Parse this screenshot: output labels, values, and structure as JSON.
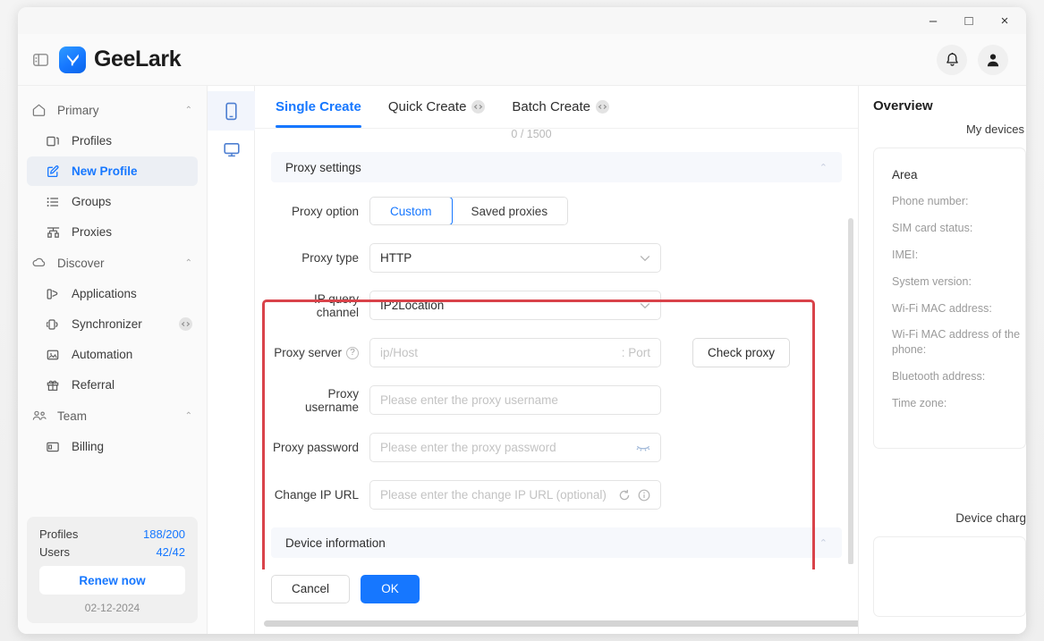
{
  "window": {
    "controls": {
      "minimize": "–",
      "maximize": "□",
      "close": "×"
    }
  },
  "header": {
    "brand_name": "GeeLark",
    "collapse_icon": "panel-collapse-icon",
    "bell_icon": "bell-icon",
    "account_icon": "account-avatar-icon"
  },
  "sidebar": {
    "groups": [
      {
        "label": "Primary",
        "icon": "home-icon",
        "chevron": "⌃",
        "items": [
          {
            "label": "Profiles",
            "icon": "profiles-icon",
            "active": false,
            "badge": false
          },
          {
            "label": "New Profile",
            "icon": "new-profile-icon",
            "active": true,
            "badge": false
          },
          {
            "label": "Groups",
            "icon": "groups-list-icon",
            "active": false,
            "badge": false
          },
          {
            "label": "Proxies",
            "icon": "proxies-network-icon",
            "active": false,
            "badge": false
          }
        ]
      },
      {
        "label": "Discover",
        "icon": "cloud-icon",
        "chevron": "⌃",
        "items": [
          {
            "label": "Applications",
            "icon": "applications-icon",
            "active": false,
            "badge": false
          },
          {
            "label": "Synchronizer",
            "icon": "synchronizer-icon",
            "active": false,
            "badge": true
          },
          {
            "label": "Automation",
            "icon": "automation-icon",
            "active": false,
            "badge": false
          },
          {
            "label": "Referral",
            "icon": "gift-icon",
            "active": false,
            "badge": false
          }
        ]
      },
      {
        "label": "Team",
        "icon": "team-people-icon",
        "chevron": "⌃",
        "items": [
          {
            "label": "Billing",
            "icon": "billing-card-icon",
            "active": false,
            "badge": false
          }
        ]
      }
    ],
    "quota": {
      "profiles_label": "Profiles",
      "profiles_value": "188/200",
      "users_label": "Users",
      "users_value": "42/42",
      "renew_label": "Renew now",
      "date": "02-12-2024"
    }
  },
  "rail": {
    "items": [
      {
        "icon": "phone-device-icon",
        "active": true
      },
      {
        "icon": "desktop-monitor-icon",
        "active": false
      }
    ]
  },
  "main": {
    "tabs": [
      {
        "label": "Single Create",
        "active": true,
        "badge": false
      },
      {
        "label": "Quick Create",
        "active": false,
        "badge": true
      },
      {
        "label": "Batch Create",
        "active": false,
        "badge": true
      }
    ],
    "counter": "0 / 1500",
    "section": {
      "title": "Proxy settings",
      "chevron": "⌃"
    },
    "fields": {
      "proxy_option": {
        "label": "Proxy option",
        "options": [
          "Custom",
          "Saved proxies"
        ],
        "selected": "Custom"
      },
      "proxy_type": {
        "label": "Proxy type",
        "value": "HTTP",
        "caret": "⌄"
      },
      "ip_query_channel": {
        "label": "IP query channel",
        "value": "IP2Location",
        "caret": "⌄"
      },
      "proxy_server": {
        "label": "Proxy server",
        "help_icon": "question-mark-icon",
        "placeholder": "ip/Host",
        "port_placeholder": ": Port",
        "check_button": "Check proxy"
      },
      "proxy_username": {
        "label": "Proxy username",
        "placeholder": "Please enter the proxy username"
      },
      "proxy_password": {
        "label": "Proxy password",
        "placeholder": "Please enter the proxy password",
        "toggle_icon": "eye-closed-icon"
      },
      "change_ip_url": {
        "label": "Change IP URL",
        "placeholder": "Please enter the change IP URL (optional)",
        "refresh_icon": "refresh-icon",
        "info_icon": "info-circle-icon"
      }
    },
    "next_section_title": "Device information",
    "footer": {
      "cancel_label": "Cancel",
      "ok_label": "OK"
    }
  },
  "overview": {
    "title": "Overview",
    "my_devices": "My devices",
    "area_label": "Area",
    "rows": [
      "Phone number:",
      "SIM card status:",
      "IMEI:",
      "System version:",
      "Wi-Fi MAC address:",
      "Wi-Fi MAC address of the phone:",
      "Bluetooth address:",
      "Time zone:"
    ],
    "device_charge": "Device charg"
  },
  "colors": {
    "accent": "#1677ff",
    "annotation": "#d9434a",
    "sidebar_bg": "#fafafa",
    "section_bg": "#f6f8fc",
    "placeholder": "#c3c3c3"
  }
}
